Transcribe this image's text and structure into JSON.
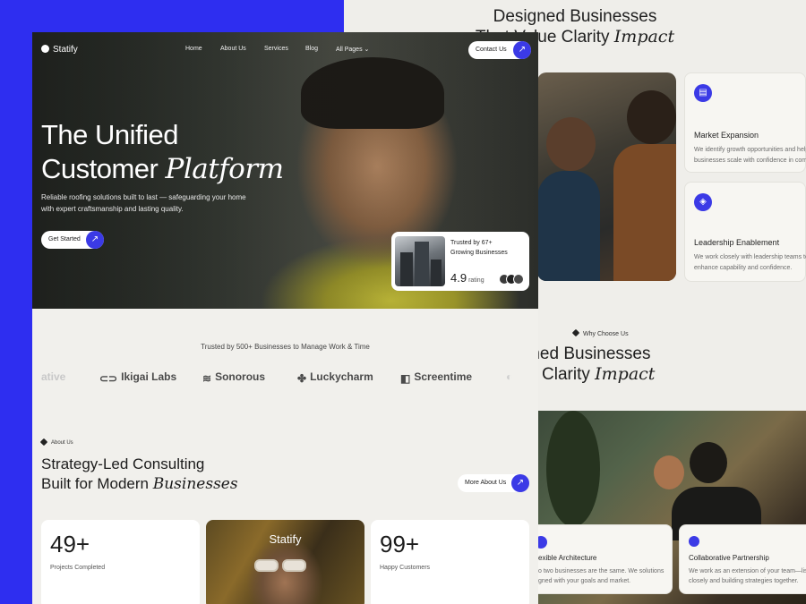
{
  "back": {
    "title_line1": "Designed Businesses",
    "title_line2_prefix": "That Value Clarity",
    "title_line2_italic": "Impact",
    "services": [
      {
        "icon": "shop-icon",
        "title": "Market Expansion",
        "desc_line1": "We identify growth opportunities and help",
        "desc_line2": "businesses scale with confidence in comp"
      },
      {
        "icon": "layers-icon",
        "title": "Leadership Enablement",
        "desc_line1": "We work closely with leadership teams to",
        "desc_line2": "enhance capability and confidence."
      }
    ],
    "why_badge": "Why Choose Us",
    "title2_line1": "esigned Businesses",
    "title2_line2_prefix": "Value Clarity",
    "title2_line2_italic": "Impact",
    "bottom_cards": [
      {
        "title": "exible Architecture",
        "desc_line1": "o two businesses are the same. We solutions",
        "desc_line2": "gned with your goals and market."
      },
      {
        "title": "Collaborative Partnership",
        "desc_line1": "We work as an extension of your team—listeni",
        "desc_line2": "closely and building strategies together."
      }
    ]
  },
  "front": {
    "logo": "Statify",
    "nav": [
      "Home",
      "About Us",
      "Services",
      "Blog",
      "All Pages"
    ],
    "contact_label": "Contact Us",
    "hero_title_line1": "The Unified",
    "hero_title_line2_prefix": "Customer",
    "hero_title_line2_italic": "Platform",
    "hero_sub_line1": "Reliable roofing solutions built to last — safeguarding your home",
    "hero_sub_line2": "with expert craftsmanship and lasting quality.",
    "cta_label": "Get Started",
    "trust_line1": "Trusted by 67+",
    "trust_line2": "Growing Businesses",
    "rating_value": "4.9",
    "rating_label": "rating",
    "trusted_line": "Trusted by 500+ Businesses to Manage Work & Time",
    "brands": [
      "ative",
      "Ikigai Labs",
      "Sonorous",
      "Luckycharm",
      "Screentime"
    ],
    "about_badge": "About Us",
    "about_title_line1": "Strategy-Led Consulting",
    "about_title_line2_prefix": "Built for Modern",
    "about_title_line2_italic": "Businesses",
    "more_label": "More About Us",
    "stats": [
      {
        "value": "49+",
        "label": "Projects Completed"
      },
      {
        "value": "99+",
        "label": "Happy Customers"
      }
    ],
    "photo_card_label": "Statify"
  },
  "colors": {
    "accent": "#3b3ae6",
    "backdrop_blue": "#2e2ef0"
  }
}
